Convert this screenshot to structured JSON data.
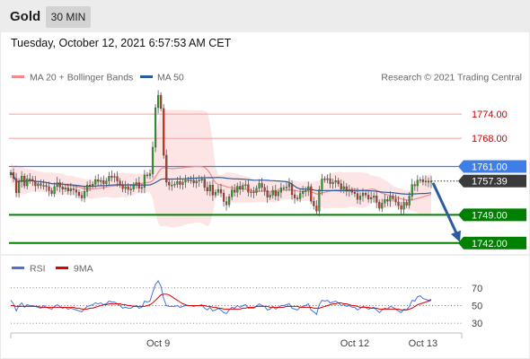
{
  "header": {
    "title": "Gold",
    "timeframe": "30 MIN"
  },
  "datetime": "Tuesday, October 12, 2021 6:57:53 AM CET",
  "colors": {
    "background": "#e9e9e9",
    "resistance": "#ff9a9a",
    "pivot": "#3d7ee8",
    "support": "#008000",
    "ma20": "#f58a8a",
    "ma50": "#2f5aa0",
    "bollinger": "#fde0e0",
    "rsi": "#4a72d8",
    "rsi_ma": "#e00000",
    "arrow": "#2b5d9e",
    "up_candle": "#2e9e2e",
    "down_candle": "#c0392b"
  },
  "chart_data": [
    {
      "type": "candlestick",
      "legend": [
        "MA 20 + Bollinger Bands",
        "MA 50"
      ],
      "legend_position": "top-left",
      "copyright": "Research © 2021 Trading Central",
      "x_ticks": [
        "Oct 9",
        "Oct 12",
        "Oct 13"
      ],
      "ylim": [
        1739.5,
        1780.5
      ],
      "grid": false,
      "levels": [
        {
          "label": "1774.00",
          "value": 1774.0,
          "kind": "resistance"
        },
        {
          "label": "1768.00",
          "value": 1768.0,
          "kind": "resistance"
        },
        {
          "label": "1761.00",
          "value": 1761.0,
          "kind": "pivot"
        },
        {
          "label": "1757.39",
          "value": 1757.39,
          "kind": "last"
        },
        {
          "label": "1749.00",
          "value": 1749.0,
          "kind": "support"
        },
        {
          "label": "1742.00",
          "value": 1742.0,
          "kind": "support"
        }
      ],
      "closes": [
        1759.5,
        1758.0,
        1754.5,
        1757.2,
        1758.6,
        1756.2,
        1757.9,
        1757.8,
        1757.4,
        1756.2,
        1756.7,
        1756.3,
        1756.3,
        1756.0,
        1755.0,
        1754.3,
        1756.0,
        1757.0,
        1755.9,
        1755.4,
        1755.7,
        1754.9,
        1755.5,
        1755.2,
        1754.6,
        1753.8,
        1753.2,
        1754.8,
        1756.4,
        1756.3,
        1756.6,
        1757.7,
        1757.3,
        1757.5,
        1756.7,
        1757.4,
        1758.6,
        1758.3,
        1758.5,
        1757.4,
        1756.4,
        1755.5,
        1756.0,
        1755.3,
        1755.4,
        1756.4,
        1757.0,
        1755.6,
        1755.8,
        1758.9,
        1758.7,
        1759.2,
        1765.8,
        1775.6,
        1778.7,
        1775.4,
        1763.8,
        1757.1,
        1756.4,
        1756.4,
        1756.6,
        1757.3,
        1756.5,
        1757.1,
        1757.7,
        1757.6,
        1757.6,
        1756.9,
        1757.4,
        1757.6,
        1757.9,
        1755.8,
        1754.9,
        1756.4,
        1753.9,
        1754.6,
        1755.3,
        1754.4,
        1752.3,
        1751.5,
        1753.5,
        1755.2,
        1754.6,
        1756.1,
        1755.4,
        1756.3,
        1756.5,
        1754.6,
        1754.7,
        1754.5,
        1755.6,
        1756.8,
        1755.8,
        1755.0,
        1753.4,
        1753.9,
        1755.1,
        1753.7,
        1754.6,
        1755.7,
        1755.7,
        1755.9,
        1756.7,
        1754.0,
        1753.2,
        1753.0,
        1754.3,
        1754.8,
        1755.1,
        1756.0,
        1752.4,
        1751.2,
        1749.9,
        1755.3,
        1757.9,
        1757.7,
        1758.0,
        1756.7,
        1757.1,
        1757.5,
        1756.7,
        1755.4,
        1756.0,
        1754.9,
        1755.2,
        1754.6,
        1754.3,
        1752.8,
        1753.7,
        1754.4,
        1753.9,
        1752.9,
        1753.3,
        1753.7,
        1752.1,
        1750.6,
        1751.9,
        1752.8,
        1752.4,
        1753.6,
        1753.0,
        1752.2,
        1751.3,
        1750.4,
        1752.1,
        1751.4,
        1753.6,
        1756.5,
        1756.2,
        1757.6,
        1757.7,
        1757.2,
        1757.4,
        1757.1,
        1757.39
      ]
    },
    {
      "type": "line",
      "series": [
        {
          "name": "RSI",
          "values": [
            56,
            52,
            44,
            50,
            53,
            48,
            51,
            50,
            50,
            49,
            48,
            47,
            50,
            48,
            47,
            46,
            49,
            51,
            49,
            47,
            48,
            46,
            47,
            46,
            45,
            44,
            43,
            46,
            49,
            50,
            51,
            53,
            52,
            53,
            51,
            52,
            55,
            54,
            54,
            52,
            50,
            47,
            48,
            47,
            47,
            49,
            50,
            47,
            48,
            55,
            54,
            55,
            65,
            74,
            78,
            72,
            58,
            50,
            49,
            49,
            49,
            50,
            48,
            49,
            50,
            50,
            50,
            49,
            50,
            50,
            51,
            47,
            45,
            48,
            44,
            45,
            47,
            45,
            42,
            41,
            45,
            48,
            47,
            50,
            48,
            50,
            51,
            47,
            47,
            47,
            49,
            52,
            50,
            49,
            45,
            46,
            49,
            46,
            48,
            50,
            50,
            51,
            52,
            47,
            46,
            45,
            48,
            49,
            50,
            52,
            45,
            43,
            40,
            51,
            56,
            55,
            56,
            53,
            54,
            55,
            53,
            50,
            51,
            49,
            50,
            48,
            48,
            45,
            47,
            49,
            48,
            46,
            47,
            48,
            45,
            42,
            45,
            47,
            46,
            49,
            48,
            46,
            44,
            42,
            46,
            45,
            49,
            56,
            55,
            60,
            61,
            58,
            57,
            56,
            57
          ]
        },
        {
          "name": "9MA",
          "values": [
            50,
            50,
            49,
            49,
            49,
            49,
            49,
            49,
            49,
            49,
            49,
            48,
            48,
            48,
            48,
            48,
            48,
            48,
            48,
            48,
            48,
            48,
            48,
            48,
            47,
            47,
            46,
            46,
            46,
            47,
            47,
            48,
            49,
            50,
            51,
            51,
            52,
            52,
            52,
            52,
            52,
            51,
            51,
            50,
            50,
            49,
            49,
            49,
            49,
            49,
            50,
            51,
            53,
            56,
            59,
            62,
            63,
            63,
            62,
            60,
            58,
            56,
            54,
            52,
            51,
            50,
            50,
            50,
            50,
            50,
            50,
            50,
            49,
            49,
            48,
            48,
            47,
            47,
            46,
            46,
            46,
            46,
            46,
            46,
            46,
            47,
            47,
            48,
            48,
            48,
            49,
            49,
            49,
            49,
            49,
            48,
            48,
            48,
            48,
            48,
            48,
            49,
            49,
            49,
            49,
            49,
            48,
            48,
            48,
            48,
            48,
            47,
            47,
            47,
            48,
            49,
            50,
            51,
            52,
            52,
            53,
            53,
            52,
            52,
            51,
            50,
            50,
            49,
            48,
            48,
            48,
            48,
            47,
            47,
            47,
            46,
            46,
            46,
            46,
            46,
            46,
            46,
            46,
            45,
            45,
            45,
            46,
            47,
            49,
            51,
            52,
            53,
            54,
            55,
            56
          ]
        }
      ],
      "y_ticks": [
        70,
        50,
        30
      ],
      "ylim": [
        20,
        85
      ],
      "legend_position": "top-left"
    }
  ]
}
